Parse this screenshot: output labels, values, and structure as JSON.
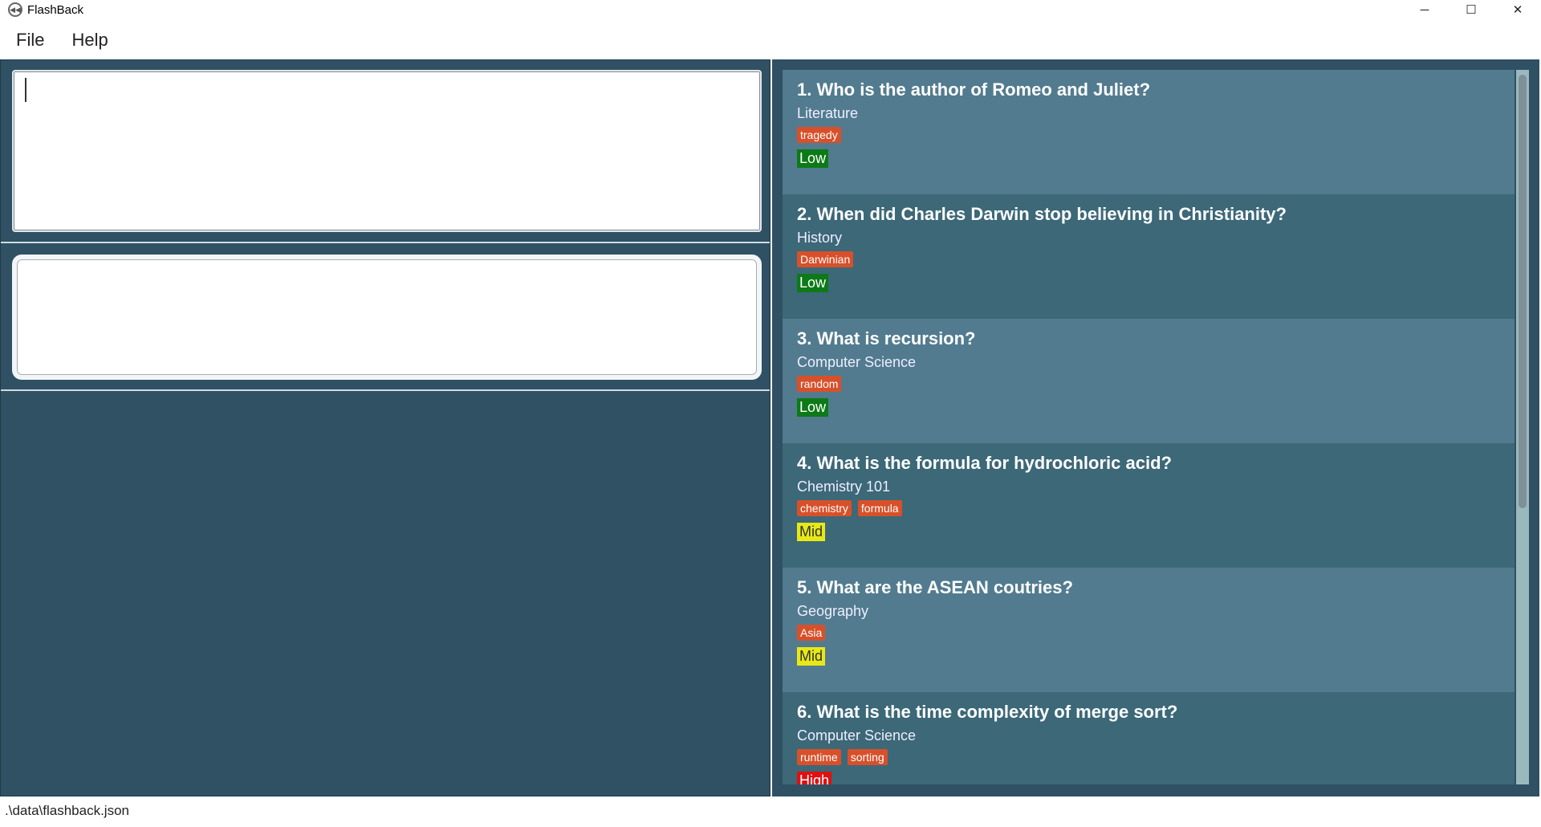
{
  "window": {
    "title": "FlashBack",
    "minimize": "─",
    "maximize": "☐",
    "close": "✕"
  },
  "menu": [
    "File",
    "Help"
  ],
  "cards": [
    {
      "question": "1.  Who is the author of Romeo and Juliet?",
      "category": "Literature",
      "tags": [
        "tragedy"
      ],
      "difficulty": "Low"
    },
    {
      "question": "2.  When did Charles Darwin stop believing in Christianity?",
      "category": "History",
      "tags": [
        "Darwinian"
      ],
      "difficulty": "Low"
    },
    {
      "question": "3.  What is recursion?",
      "category": "Computer Science",
      "tags": [
        "random"
      ],
      "difficulty": "Low"
    },
    {
      "question": "4.  What is the formula for hydrochloric acid?",
      "category": "Chemistry 101",
      "tags": [
        "chemistry",
        "formula"
      ],
      "difficulty": "Mid"
    },
    {
      "question": "5.  What are the ASEAN coutries?",
      "category": "Geography",
      "tags": [
        "Asia"
      ],
      "difficulty": "Mid"
    },
    {
      "question": "6.  What is the time complexity of merge sort?",
      "category": "Computer Science",
      "tags": [
        "runtime",
        "sorting"
      ],
      "difficulty": "High"
    }
  ],
  "colors": {
    "Low": "#0c7a16",
    "Mid": "#e8e817",
    "High": "#e01010"
  },
  "status": {
    "file_path": ".\\data\\flashback.json"
  }
}
